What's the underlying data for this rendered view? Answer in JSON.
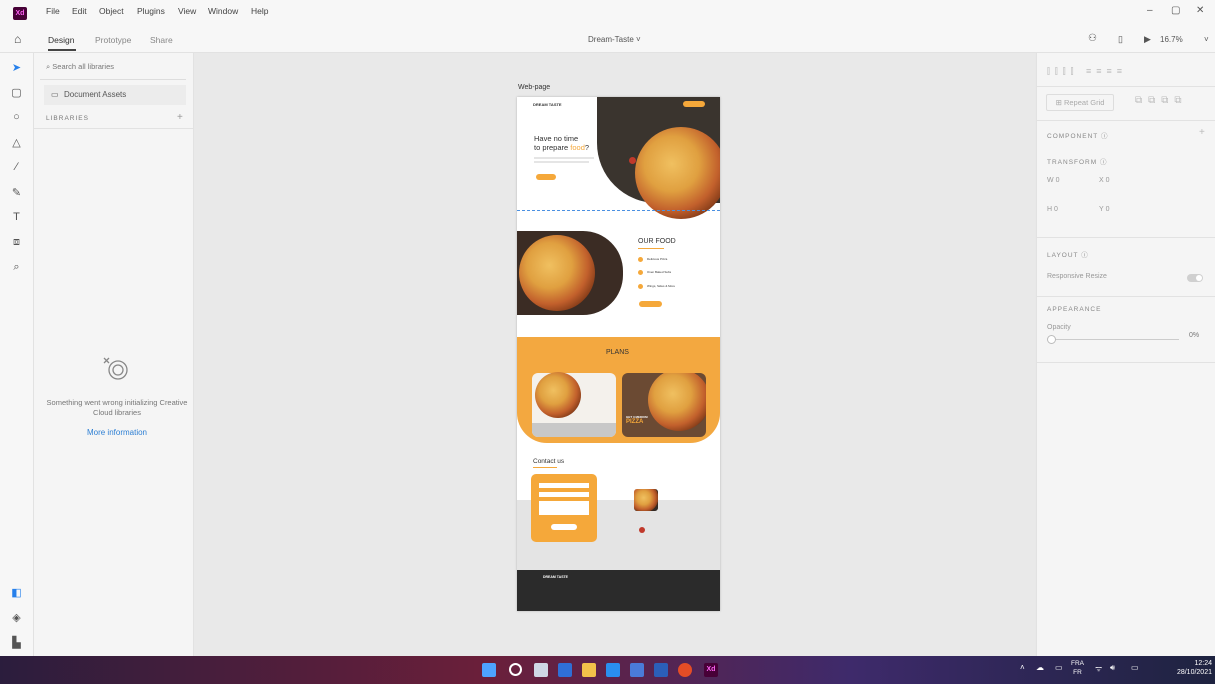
{
  "app": {
    "badge": "Xd",
    "menu": [
      "File",
      "Edit",
      "Object",
      "Plugins",
      "View",
      "Window",
      "Help"
    ],
    "window_controls": [
      "–",
      "▢",
      "✕"
    ]
  },
  "toolbar": {
    "tabs": [
      "Design",
      "Prototype",
      "Share"
    ],
    "document_title": "Dream-Taste",
    "zoom": "16.7%"
  },
  "libraries": {
    "search_placeholder": "Search all libraries",
    "document_assets": "Document Assets",
    "libraries_label": "LIBRARIES",
    "error_text": "Something went wrong initializing Creative Cloud libraries",
    "more_info": "More information"
  },
  "properties": {
    "repeat_grid": "Repeat Grid",
    "component_label": "COMPONENT",
    "transform_label": "TRANSFORM",
    "w_label": "W",
    "w_value": "0",
    "x_label": "X",
    "x_value": "0",
    "h_label": "H",
    "h_value": "0",
    "y_label": "Y",
    "y_value": "0",
    "layout_label": "LAYOUT",
    "responsive_resize": "Responsive Resize",
    "appearance_label": "APPEARANCE",
    "opacity_label": "Opacity",
    "opacity_value": "0%"
  },
  "artboard": {
    "label": "Web-page",
    "logo": "DREAM TASTE",
    "hero_line1": "Have no time",
    "hero_line2_pre": "to prepare ",
    "hero_line2_accent": "food",
    "hero_line2_post": "?",
    "our_food_title": "OUR FOOD",
    "food_items": [
      "Delicious Pizza",
      "Oven Baked Subs",
      "Wings, Sides & More"
    ],
    "plans_title": "PLANS",
    "plan2_line1": "GET 3 MEDIUM",
    "plan2_line2": "PIZZA",
    "contact_title": "Contact us"
  },
  "taskbar": {
    "lang_top": "FRA",
    "lang_bottom": "FR",
    "time": "12:24",
    "date": "28/10/2021"
  },
  "colors": {
    "accent": "#f5a83a",
    "xd_purple": "#470137",
    "link_blue": "#2d7fd4"
  }
}
